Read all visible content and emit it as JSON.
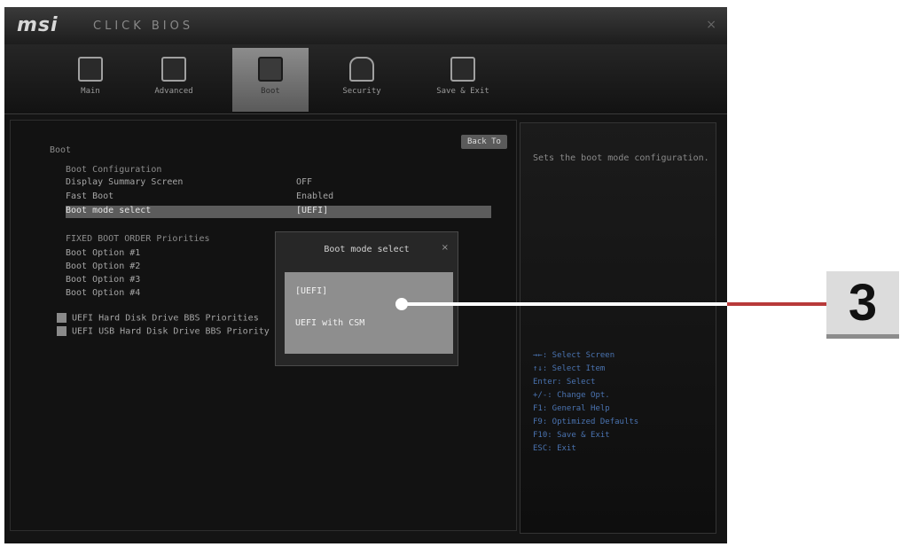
{
  "header": {
    "logo": "msi",
    "title": "CLICK BIOS"
  },
  "tabs": [
    {
      "label": "Main",
      "icon": "monitor-icon",
      "active": false
    },
    {
      "label": "Advanced",
      "icon": "advanced-icon",
      "active": false
    },
    {
      "label": "Boot",
      "icon": "boot-icon",
      "active": true
    },
    {
      "label": "Security",
      "icon": "lock-icon",
      "active": false
    },
    {
      "label": "Save & Exit",
      "icon": "save-icon",
      "active": false
    }
  ],
  "main": {
    "back_label": "Back To",
    "section_title": "Boot",
    "boot_config_label": "Boot Configuration",
    "settings": [
      {
        "label": "Display Summary Screen",
        "value": "OFF"
      },
      {
        "label": "Fast Boot",
        "value": "Enabled"
      },
      {
        "label": "Boot mode select",
        "value": "[UEFI]",
        "selected": true
      }
    ],
    "priorities_label": "FIXED BOOT ORDER Priorities",
    "boot_options": [
      {
        "label": "Boot Option #1"
      },
      {
        "label": "Boot Option #2"
      },
      {
        "label": "Boot Option #3"
      },
      {
        "label": "Boot Option #4"
      }
    ],
    "priority_items": [
      "UEFI Hard Disk Drive BBS Priorities",
      "UEFI USB Hard Disk Drive BBS Priority"
    ]
  },
  "popup": {
    "title": "Boot mode select",
    "close": "×",
    "options": [
      "[UEFI]",
      "UEFI with CSM"
    ]
  },
  "help": {
    "text": "Sets the boot mode configuration.",
    "keys": [
      "→←: Select Screen",
      "↑↓: Select Item",
      "Enter: Select",
      "+/-: Change Opt.",
      "F1: General Help",
      "F9: Optimized Defaults",
      "F10: Save & Exit",
      "ESC: Exit"
    ]
  },
  "callout": {
    "number": "3",
    "line_color": "#b83a3a"
  }
}
